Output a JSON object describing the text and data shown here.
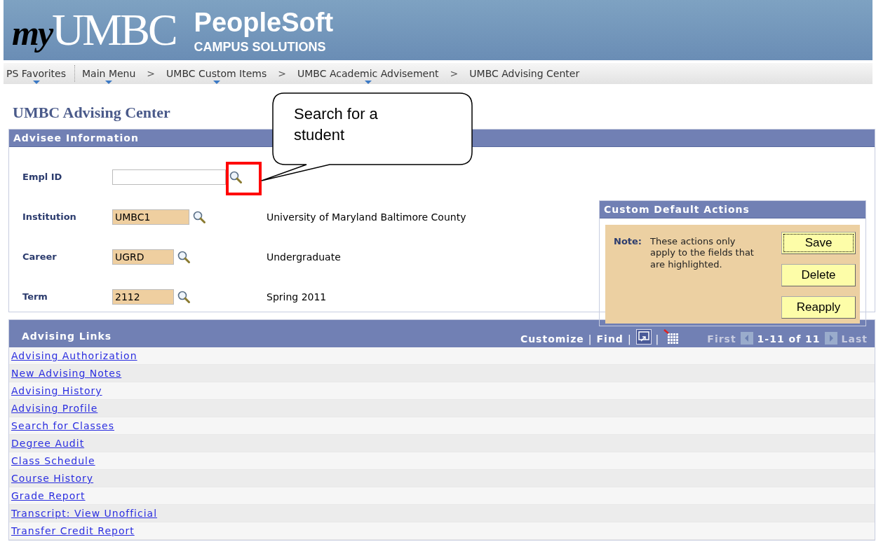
{
  "banner": {
    "logo_prefix": "my",
    "logo_name": "UMBC",
    "product": "PeopleSoft",
    "subproduct": "CAMPUS SOLUTIONS"
  },
  "nav": {
    "favorites": {
      "label": "PS Favorites",
      "menu": true
    },
    "crumbs": [
      {
        "label": "Main Menu",
        "menu": true
      },
      {
        "separator": ">",
        "label": "UMBC Custom Items",
        "menu": true
      },
      {
        "separator": ">",
        "label": "UMBC Academic Advisement",
        "menu": true
      },
      {
        "separator": ">",
        "label": "UMBC Advising Center",
        "menu": false
      }
    ]
  },
  "page_title": "UMBC Advising Center",
  "advisee": {
    "title": "Advisee Information",
    "fields": [
      {
        "label": "Empl ID",
        "highlighted": false
      },
      {
        "label": "Institution",
        "value": "UMBC1",
        "highlighted": true,
        "description": "University of Maryland Baltimore County"
      },
      {
        "label": "Career",
        "value": "UGRD",
        "highlighted": true,
        "description": "Undergraduate"
      },
      {
        "label": "Term",
        "value": "2112",
        "highlighted": true,
        "description": "Spring 2011"
      }
    ],
    "defaults": {
      "title": "Custom Default Actions",
      "note_label": "Note:",
      "note_text": "These actions only apply to the fields that are highlighted.",
      "buttons": [
        {
          "label": "Save",
          "focused": true
        },
        {
          "label": "Delete",
          "focused": false
        },
        {
          "label": "Reapply",
          "focused": false
        }
      ]
    }
  },
  "callout": {
    "text": "Search for a student"
  },
  "links": {
    "title": "Advising Links",
    "customize": "Customize",
    "find": "Find",
    "pipes": [
      "|",
      "|",
      "|"
    ],
    "first": {
      "label": "First",
      "disabled": true
    },
    "range": "1-11 of 11",
    "last": {
      "label": "Last",
      "disabled": true
    },
    "items": [
      "Advising Authorization",
      "New Advising Notes",
      "Advising History",
      "Advising Profile",
      "Search for Classes",
      "Degree Audit",
      "Class Schedule",
      "Course History",
      "Grade Report",
      "Transcript: View Unofficial",
      "Transfer Credit Report"
    ]
  }
}
